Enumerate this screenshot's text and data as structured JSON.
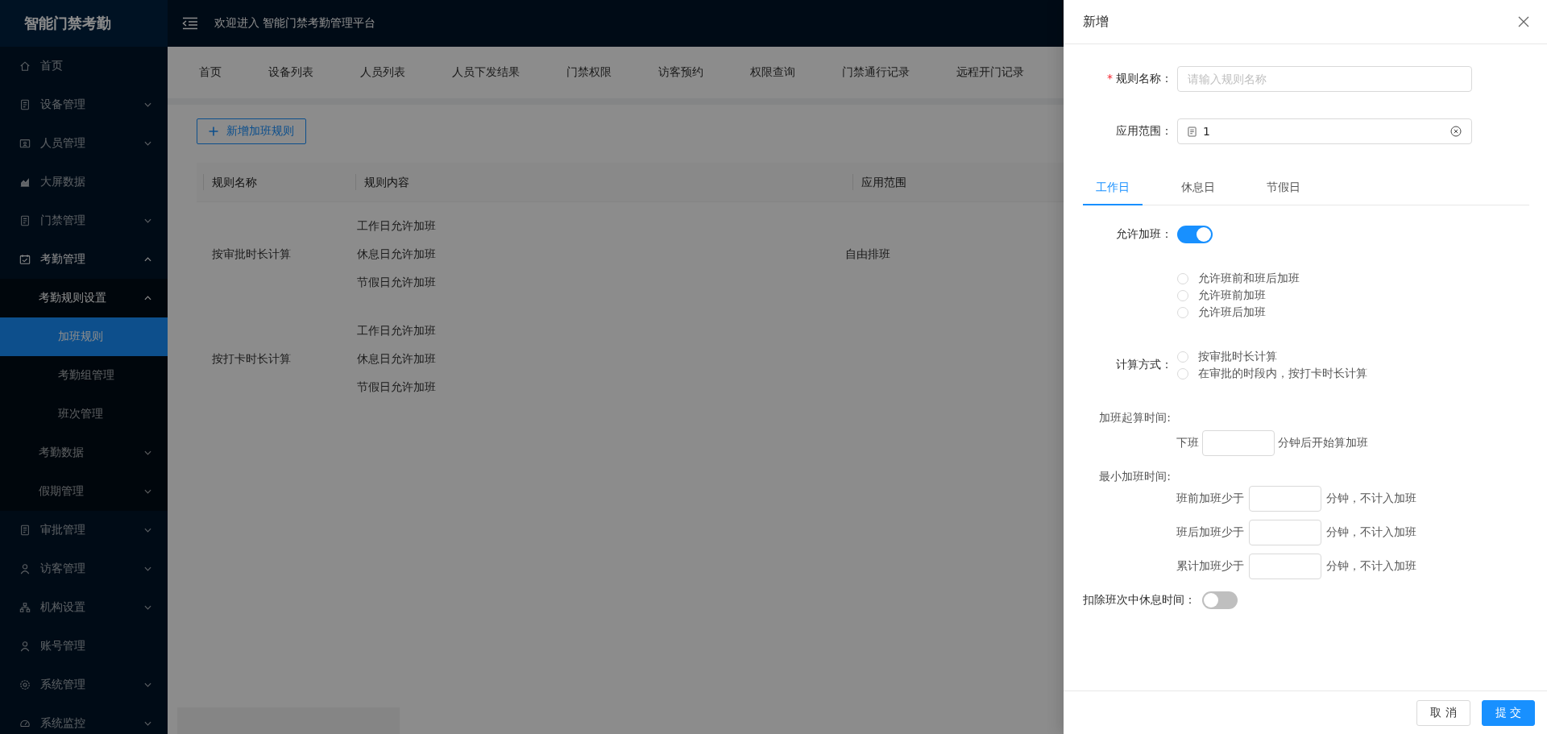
{
  "sidebar": {
    "title": "智能门禁考勤",
    "items": [
      {
        "label": "首页",
        "selected": false
      },
      {
        "label": "设备管理",
        "expanded": false,
        "selected": false
      },
      {
        "label": "人员管理",
        "expanded": false,
        "selected": false
      },
      {
        "label": "大屏数据",
        "selected": false
      },
      {
        "label": "门禁管理",
        "expanded": false,
        "selected": false
      },
      {
        "label": "考勤管理",
        "expanded": true,
        "selected": false,
        "children": [
          {
            "label": "考勤规则设置",
            "expanded": true,
            "selected": false,
            "children": [
              {
                "label": "加班规则",
                "selected": true
              },
              {
                "label": "考勤组管理",
                "selected": false
              },
              {
                "label": "班次管理",
                "selected": false
              }
            ]
          },
          {
            "label": "考勤数据",
            "expanded": false,
            "selected": false
          },
          {
            "label": "假期管理",
            "expanded": false,
            "selected": false
          }
        ]
      },
      {
        "label": "审批管理",
        "expanded": false,
        "selected": false
      },
      {
        "label": "访客管理",
        "expanded": false,
        "selected": false
      },
      {
        "label": "机构设置",
        "expanded": false,
        "selected": false
      },
      {
        "label": "账号管理",
        "selected": false
      },
      {
        "label": "系统管理",
        "expanded": false,
        "selected": false
      },
      {
        "label": "系统监控",
        "expanded": false,
        "selected": false
      }
    ]
  },
  "header": {
    "welcome": "欢迎进入 智能门禁考勤管理平台"
  },
  "tabs": [
    {
      "label": "首页",
      "selected": false
    },
    {
      "label": "设备列表",
      "selected": false
    },
    {
      "label": "人员列表",
      "selected": false
    },
    {
      "label": "人员下发结果",
      "selected": false
    },
    {
      "label": "门禁权限",
      "selected": false
    },
    {
      "label": "访客预约",
      "selected": false
    },
    {
      "label": "权限查询",
      "selected": false
    },
    {
      "label": "门禁通行记录",
      "selected": false
    },
    {
      "label": "远程开门记录",
      "selected": false
    }
  ],
  "add_button": "新增加班规则",
  "table": {
    "columns": [
      "规则名称",
      "规则内容",
      "应用范围"
    ],
    "rows": [
      {
        "name": "按审批时长计算",
        "content": [
          "工作日允许加班",
          "休息日允许加班",
          "节假日允许加班"
        ],
        "scope": "自由排班"
      },
      {
        "name": "按打卡时长计算",
        "content": [
          "工作日允许加班",
          "休息日允许加班",
          "节假日允许加班"
        ]
      }
    ]
  },
  "drawer": {
    "title": "新增",
    "fields": [
      {
        "label": "规则名称：",
        "required_mark": "*",
        "placeholder": "请输入规则名称"
      },
      {
        "label": "应用范围：",
        "value": "1"
      }
    ],
    "tabs": [
      {
        "label": "工作日",
        "selected": true
      },
      {
        "label": "休息日",
        "selected": false
      },
      {
        "label": "节假日",
        "selected": false
      }
    ],
    "allow": {
      "label": "允许加班：",
      "on": true
    },
    "timing_options": [
      {
        "label": "允许班前和班后加班",
        "selected": false
      },
      {
        "label": "允许班前加班",
        "selected": false
      },
      {
        "label": "允许班后加班",
        "selected": false
      }
    ],
    "calc": {
      "label": "计算方式：",
      "options": [
        {
          "label": "按审批时长计算",
          "selected": false
        },
        {
          "label": "在审批的时段内，按打卡时长计算",
          "selected": false
        }
      ]
    },
    "start": {
      "label": "加班起算时间:",
      "prefix": "下班",
      "suffix": "分钟后开始算加班"
    },
    "minimum": {
      "label": "最小加班时间:",
      "rows": [
        {
          "prefix": "班前加班少于",
          "suffix": "分钟，不计入加班"
        },
        {
          "prefix": "班后加班少于",
          "suffix": "分钟，不计入加班"
        },
        {
          "prefix": "累计加班少于",
          "suffix": "分钟，不计入加班"
        }
      ]
    },
    "deduct": {
      "label": "扣除班次中休息时间：",
      "on": false
    },
    "buttons": [
      {
        "label": "取 消",
        "kind": "default"
      },
      {
        "label": "提 交",
        "kind": "primary"
      }
    ]
  }
}
